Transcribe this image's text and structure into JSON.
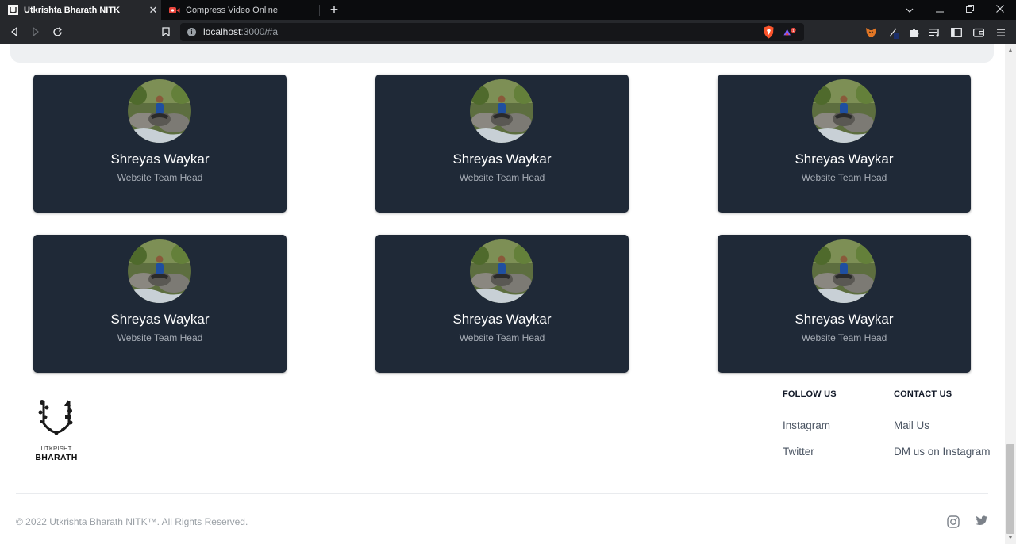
{
  "browser": {
    "tabs": [
      {
        "title": "Utkrishta Bharath NITK",
        "active": true
      },
      {
        "title": "Compress Video Online",
        "active": false
      }
    ],
    "url_host": "localhost",
    "url_rest": ":3000/#a",
    "brave_badge": "1"
  },
  "team": {
    "members": [
      {
        "name": "Shreyas Waykar",
        "role": "Website Team Head"
      },
      {
        "name": "Shreyas Waykar",
        "role": "Website Team Head"
      },
      {
        "name": "Shreyas Waykar",
        "role": "Website Team Head"
      },
      {
        "name": "Shreyas Waykar",
        "role": "Website Team Head"
      },
      {
        "name": "Shreyas Waykar",
        "role": "Website Team Head"
      },
      {
        "name": "Shreyas Waykar",
        "role": "Website Team Head"
      }
    ]
  },
  "footer": {
    "logo_sub": "UTKRISHT",
    "logo_main": "BHARATH",
    "follow": {
      "heading": "FOLLOW US",
      "links": [
        "Instagram",
        "Twitter"
      ]
    },
    "contact": {
      "heading": "CONTACT US",
      "links": [
        "Mail Us",
        "DM us on Instagram"
      ]
    },
    "copyright": "© 2022 Utkrishta Bharath NITK™. All Rights Reserved."
  },
  "colors": {
    "card_bg": "#1f2937",
    "role_text": "#a7adb6",
    "tab_active": "#26282c"
  }
}
